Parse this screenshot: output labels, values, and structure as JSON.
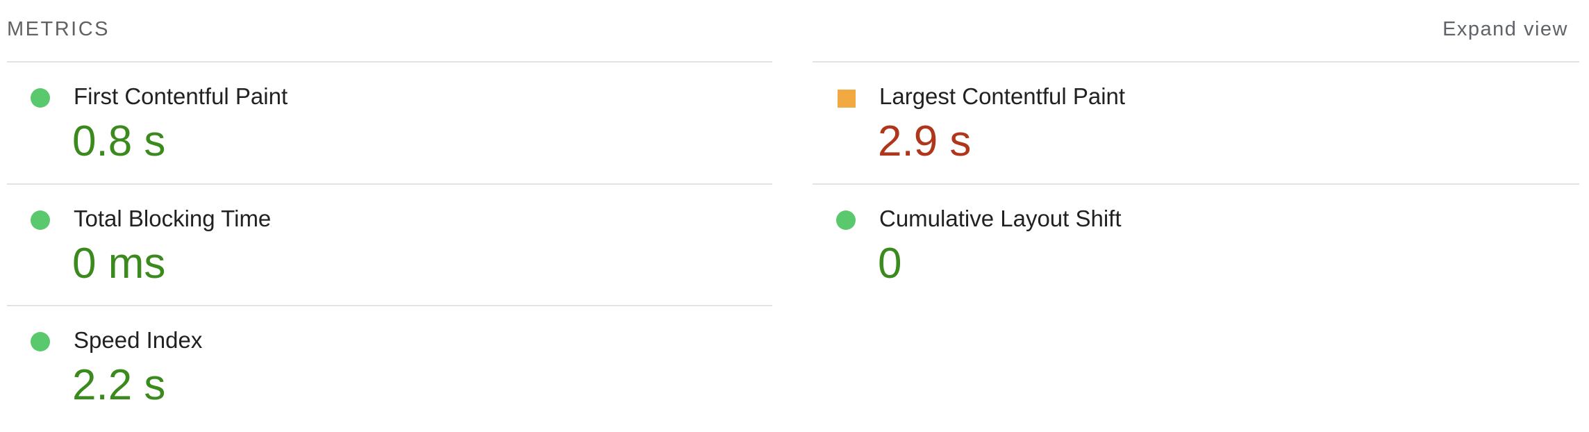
{
  "header": {
    "title": "METRICS",
    "expand_label": "Expand view"
  },
  "colors": {
    "pass": "#5ac96d",
    "pass_text": "#3b8a1e",
    "average": "#f2a942",
    "fail_text": "#b0361b"
  },
  "metrics": [
    {
      "label": "First Contentful Paint",
      "value": "0.8 s",
      "rating": "pass",
      "indicator": "green-circle-icon"
    },
    {
      "label": "Largest Contentful Paint",
      "value": "2.9 s",
      "rating": "average",
      "indicator": "orange-square-icon"
    },
    {
      "label": "Total Blocking Time",
      "value": "0 ms",
      "rating": "pass",
      "indicator": "green-circle-icon"
    },
    {
      "label": "Cumulative Layout Shift",
      "value": "0",
      "rating": "pass",
      "indicator": "green-circle-icon"
    },
    {
      "label": "Speed Index",
      "value": "2.2 s",
      "rating": "pass",
      "indicator": "green-circle-icon"
    }
  ]
}
